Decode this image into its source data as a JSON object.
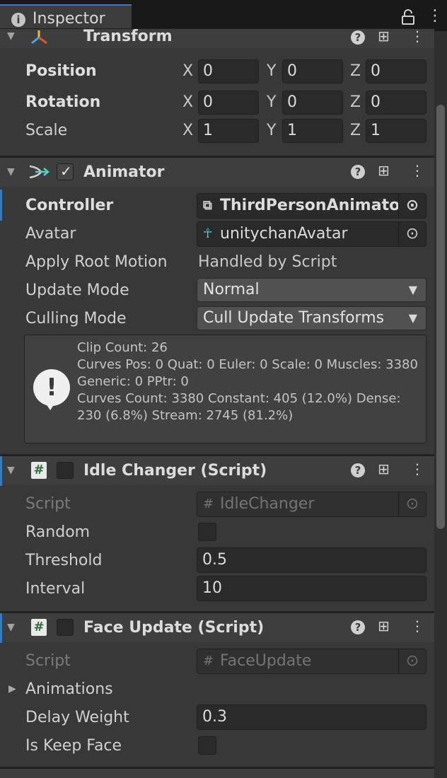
{
  "window": {
    "tab_title": "Inspector",
    "tab_icon": "info-icon",
    "lock_icon": "lock-icon",
    "menu_icon": "kebab-menu-icon"
  },
  "colors": {
    "background": "#383838",
    "header_background": "#3e3e3e",
    "field_background": "#2a2a2a",
    "accent": "#3a79bb"
  },
  "transform": {
    "title": "Transform",
    "rows": [
      {
        "label": "Position",
        "x": "0",
        "y": "0",
        "z": "0"
      },
      {
        "label": "Rotation",
        "x": "0",
        "y": "0",
        "z": "0"
      },
      {
        "label": "Scale",
        "x": "1",
        "y": "1",
        "z": "1"
      }
    ],
    "axis_x": "X",
    "axis_y": "Y",
    "axis_z": "Z"
  },
  "animator": {
    "title": "Animator",
    "enabled": true,
    "controller_label": "Controller",
    "controller_value": "ThirdPersonAnimatorC",
    "avatar_label": "Avatar",
    "avatar_value": "unitychanAvatar",
    "apply_root_motion_label": "Apply Root Motion",
    "apply_root_motion_value": "Handled by Script",
    "update_mode_label": "Update Mode",
    "update_mode_value": "Normal",
    "culling_mode_label": "Culling Mode",
    "culling_mode_value": "Cull Update Transforms",
    "info_lines": [
      "Clip Count: 26",
      "Curves Pos: 0 Quat: 0 Euler: 0 Scale: 0 Muscles: 3380 Generic: 0 PPtr: 0",
      "Curves Count: 3380 Constant: 405 (12.0%) Dense: 230 (6.8%) Stream: 2745 (81.2%)"
    ]
  },
  "idle_changer": {
    "title": "Idle Changer (Script)",
    "enabled": false,
    "script_label": "Script",
    "script_value": "IdleChanger",
    "random_label": "Random",
    "random_checked": false,
    "threshold_label": "Threshold",
    "threshold_value": "0.5",
    "interval_label": "Interval",
    "interval_value": "10"
  },
  "face_update": {
    "title": "Face Update (Script)",
    "enabled": false,
    "script_label": "Script",
    "script_value": "FaceUpdate",
    "animations_label": "Animations",
    "delay_weight_label": "Delay Weight",
    "delay_weight_value": "0.3",
    "is_keep_face_label": "Is Keep Face",
    "is_keep_face_checked": false
  }
}
